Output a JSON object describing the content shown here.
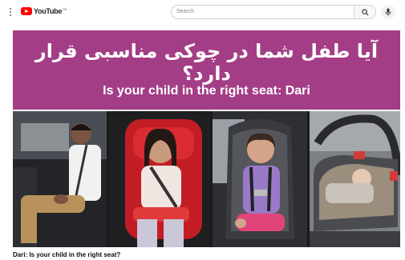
{
  "header": {
    "logo_text": "YouTube",
    "logo_sup": "DE",
    "search_placeholder": "Search"
  },
  "banner": {
    "title_fa": "آیا طفل شما در چوکی مناسبی قرار دارد؟",
    "title_en": "Is your child in the right seat: Dari"
  },
  "video": {
    "caption": "Dari: Is your child in the right seat?"
  },
  "colors": {
    "banner": "#a33d86",
    "youtube_red": "#ff0000"
  },
  "icons": [
    "menu-icon",
    "youtube-logo-icon",
    "search-icon",
    "mic-icon"
  ]
}
